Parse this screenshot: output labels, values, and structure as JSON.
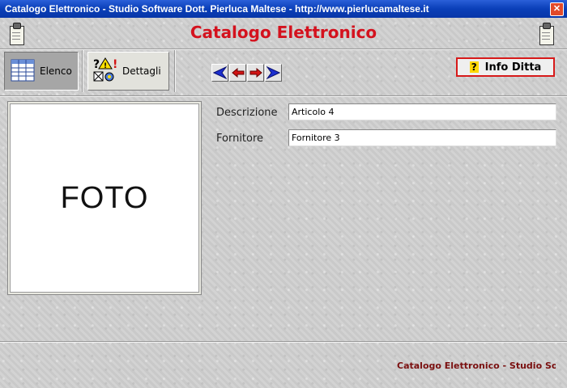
{
  "window": {
    "title": "Catalogo Elettronico - Studio Software Dott. Pierluca Maltese - http://www.pierlucamaltese.it",
    "close_label": "✕"
  },
  "header": {
    "app_title": "Catalogo Elettronico"
  },
  "tabs": {
    "elenco_label": "Elenco",
    "dettagli_label": "Dettagli"
  },
  "info_button": {
    "label": "Info Ditta",
    "icon_glyph": "?"
  },
  "photo": {
    "placeholder": "FOTO"
  },
  "fields": {
    "descrizione_label": "Descrizione",
    "descrizione_value": "Articolo 4",
    "fornitore_label": "Fornitore",
    "fornitore_value": "Fornitore 3"
  },
  "status": {
    "text": "Catalogo Elettronico - Studio Software"
  },
  "colors": {
    "title_red": "#d4121e",
    "nav_arrow_blue": "#1c2fd0",
    "nav_arrow_red": "#d21414",
    "titlebar_blue": "#0a3fb8"
  }
}
